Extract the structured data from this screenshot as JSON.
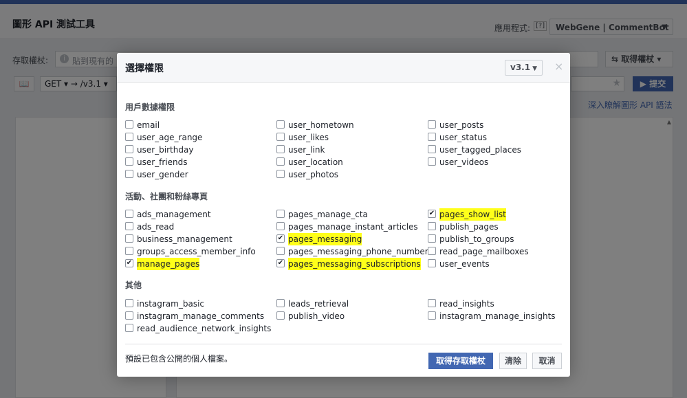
{
  "page": {
    "title": "圖形 API 測試工具",
    "app_label": "應用程式:",
    "app_help": "[?]",
    "app_name": "WebGene | CommentBot",
    "token_label": "存取權杖:",
    "token_placeholder": "貼到現有的",
    "get_token_button": "⇆ 取得權杖 ▾",
    "method": "GET ▾ → /v3.1 ▾",
    "submit_button": "▶ 提交",
    "learn_link": "深入瞭解圖形 API 語法"
  },
  "dialog": {
    "title": "選擇權限",
    "version": "v3.1",
    "close": "×",
    "sections": [
      {
        "title": "用戶數據權限",
        "items": [
          {
            "label": "email",
            "checked": false
          },
          {
            "label": "user_age_range",
            "checked": false
          },
          {
            "label": "user_birthday",
            "checked": false
          },
          {
            "label": "user_friends",
            "checked": false
          },
          {
            "label": "user_gender",
            "checked": false
          },
          {
            "label": "user_hometown",
            "checked": false
          },
          {
            "label": "user_likes",
            "checked": false
          },
          {
            "label": "user_link",
            "checked": false
          },
          {
            "label": "user_location",
            "checked": false
          },
          {
            "label": "user_photos",
            "checked": false
          },
          {
            "label": "user_posts",
            "checked": false
          },
          {
            "label": "user_status",
            "checked": false
          },
          {
            "label": "user_tagged_places",
            "checked": false
          },
          {
            "label": "user_videos",
            "checked": false
          }
        ]
      },
      {
        "title": "活動、社團和粉絲專頁",
        "items": [
          {
            "label": "ads_management",
            "checked": false
          },
          {
            "label": "ads_read",
            "checked": false
          },
          {
            "label": "business_management",
            "checked": false
          },
          {
            "label": "groups_access_member_info",
            "checked": false
          },
          {
            "label": "manage_pages",
            "checked": true
          },
          {
            "label": "pages_manage_cta",
            "checked": false
          },
          {
            "label": "pages_manage_instant_articles",
            "checked": false
          },
          {
            "label": "pages_messaging",
            "checked": true
          },
          {
            "label": "pages_messaging_phone_number",
            "checked": false
          },
          {
            "label": "pages_messaging_subscriptions",
            "checked": true
          },
          {
            "label": "pages_show_list",
            "checked": true
          },
          {
            "label": "publish_pages",
            "checked": false
          },
          {
            "label": "publish_to_groups",
            "checked": false
          },
          {
            "label": "read_page_mailboxes",
            "checked": false
          },
          {
            "label": "user_events",
            "checked": false
          }
        ]
      },
      {
        "title": "其他",
        "items": [
          {
            "label": "instagram_basic",
            "checked": false
          },
          {
            "label": "instagram_manage_comments",
            "checked": false
          },
          {
            "label": "read_audience_network_insights",
            "checked": false
          },
          {
            "label": "leads_retrieval",
            "checked": false
          },
          {
            "label": "publish_video",
            "checked": false
          },
          {
            "label": "read_insights",
            "checked": false
          },
          {
            "label": "instagram_manage_insights",
            "checked": false
          }
        ]
      }
    ],
    "footer_note": "預設已包含公開的個人檔案。",
    "get_token_button": "取得存取權杖",
    "clear_button": "清除",
    "cancel_button": "取消"
  },
  "colors": {
    "accent": "#4267b2",
    "highlight": "#ffff1a"
  }
}
